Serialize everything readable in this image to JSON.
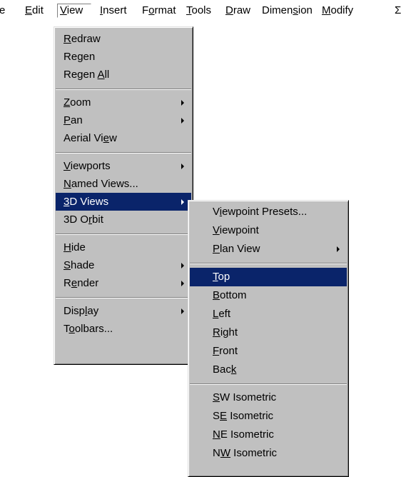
{
  "menubar": {
    "items": [
      {
        "text": "e",
        "ul": -1
      },
      {
        "text": "Edit",
        "ul": 0
      },
      {
        "text": "View",
        "ul": 0
      },
      {
        "text": "Insert",
        "ul": 0
      },
      {
        "text": "Format",
        "ul": 1
      },
      {
        "text": "Tools",
        "ul": 0
      },
      {
        "text": "Draw",
        "ul": 0
      },
      {
        "text": "Dimension",
        "ul": 5
      },
      {
        "text": "Modify",
        "ul": 0
      },
      {
        "text": "Σ",
        "ul": -1
      }
    ]
  },
  "view_menu": {
    "groups": [
      [
        {
          "text": "Redraw",
          "ul": 0
        },
        {
          "text": "Regen",
          "ul": 2
        },
        {
          "text": "Regen All",
          "ul": 6
        }
      ],
      [
        {
          "text": "Zoom",
          "ul": 0,
          "sub": true
        },
        {
          "text": "Pan",
          "ul": 0,
          "sub": true
        },
        {
          "text": "Aerial View",
          "ul": 9
        }
      ],
      [
        {
          "text": "Viewports",
          "ul": 0,
          "sub": true
        },
        {
          "text": "Named Views...",
          "ul": 0
        },
        {
          "text": "3D Views",
          "ul": 0,
          "sub": true,
          "hl": true
        },
        {
          "text": "3D Orbit",
          "ul": 4
        }
      ],
      [
        {
          "text": "Hide",
          "ul": 0
        },
        {
          "text": "Shade",
          "ul": 0,
          "sub": true
        },
        {
          "text": "Render",
          "ul": 1,
          "sub": true
        }
      ],
      [
        {
          "text": "Display",
          "ul": 4,
          "sub": true
        },
        {
          "text": "Toolbars...",
          "ul": 1
        }
      ]
    ]
  },
  "views_submenu": {
    "groups": [
      [
        {
          "text": "Viewpoint Presets...",
          "ul": 1
        },
        {
          "text": "Viewpoint",
          "ul": 0
        },
        {
          "text": "Plan View",
          "ul": 0,
          "sub": true
        }
      ],
      [
        {
          "text": "Top",
          "ul": 0,
          "hl": true
        },
        {
          "text": "Bottom",
          "ul": 0
        },
        {
          "text": "Left",
          "ul": 0
        },
        {
          "text": "Right",
          "ul": 0
        },
        {
          "text": "Front",
          "ul": 0
        },
        {
          "text": "Back",
          "ul": 3
        }
      ],
      [
        {
          "text": "SW Isometric",
          "ul": 0
        },
        {
          "text": "SE Isometric",
          "ul": 1
        },
        {
          "text": "NE Isometric",
          "ul": 0
        },
        {
          "text": "NW Isometric",
          "ul": 1
        }
      ]
    ]
  },
  "colors": {
    "menu_face": "#c0c0c0",
    "highlight": "#0a246a",
    "highlight_text": "#ffffff"
  }
}
